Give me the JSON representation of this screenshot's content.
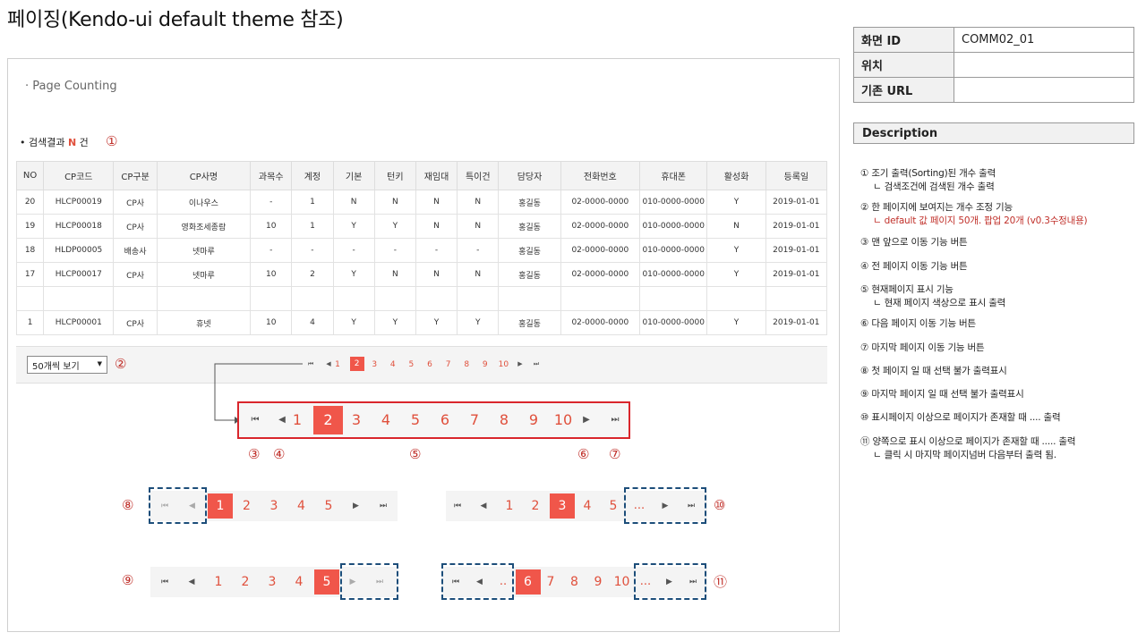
{
  "title": "페이징(Kendo-ui default theme 참조)",
  "section_title": "· Page Counting",
  "result": {
    "prefix": "• 검색결과 ",
    "n": "N",
    "suffix": " 건"
  },
  "markers": [
    "①",
    "②",
    "③",
    "④",
    "⑤",
    "⑥",
    "⑦",
    "⑧",
    "⑨",
    "⑩",
    "⑪"
  ],
  "grid": {
    "columns": [
      "NO",
      "CP코드",
      "CP구분",
      "CP사명",
      "과목수",
      "계정",
      "기본",
      "턴키",
      "재임대",
      "특이건",
      "담당자",
      "전화번호",
      "휴대폰",
      "활성화",
      "등록일"
    ],
    "rows": [
      [
        "20",
        "HLCP00019",
        "CP사",
        "이나우스",
        "-",
        "1",
        "N",
        "N",
        "N",
        "N",
        "홍길동",
        "02-0000-0000",
        "010-0000-0000",
        "Y",
        "2019-01-01"
      ],
      [
        "19",
        "HLCP00018",
        "CP사",
        "영화조세종람",
        "10",
        "1",
        "Y",
        "Y",
        "N",
        "N",
        "홍길동",
        "02-0000-0000",
        "010-0000-0000",
        "N",
        "2019-01-01"
      ],
      [
        "18",
        "HLDP00005",
        "배송사",
        "넷마루",
        "-",
        "-",
        "-",
        "-",
        "-",
        "-",
        "홍길동",
        "02-0000-0000",
        "010-0000-0000",
        "Y",
        "2019-01-01"
      ],
      [
        "17",
        "HLCP00017",
        "CP사",
        "넷마루",
        "10",
        "2",
        "Y",
        "N",
        "N",
        "N",
        "홍길동",
        "02-0000-0000",
        "010-0000-0000",
        "Y",
        "2019-01-01"
      ],
      [
        "",
        "",
        "",
        "",
        "",
        "",
        "",
        "",
        "",
        "",
        "",
        "",
        "",
        "",
        ""
      ],
      [
        "1",
        "HLCP00001",
        "CP사",
        "휴넷",
        "10",
        "4",
        "Y",
        "Y",
        "Y",
        "Y",
        "홍길동",
        "02-0000-0000",
        "010-0000-0000",
        "Y",
        "2019-01-01"
      ]
    ]
  },
  "page_size_label": "50개씩 보기",
  "pager": {
    "first": "⏮",
    "prev": "◀",
    "next": "▶",
    "last": "⏭",
    "pages": [
      "1",
      "2",
      "3",
      "4",
      "5",
      "6",
      "7",
      "8",
      "9",
      "10"
    ],
    "current": "2"
  },
  "examples": {
    "first_page": {
      "pages": [
        "1",
        "2",
        "3",
        "4",
        "5"
      ],
      "current": "1"
    },
    "last_page": {
      "pages": [
        "1",
        "2",
        "3",
        "4",
        "5"
      ],
      "current": "5"
    },
    "more_right": {
      "pages": [
        "1",
        "2",
        "3",
        "4",
        "5"
      ],
      "current": "3",
      "dots": "..."
    },
    "both_sides": {
      "pages": [
        "6",
        "7",
        "8",
        "9",
        "10"
      ],
      "current": "6",
      "dots_left": "..",
      "dots_right": "..."
    }
  },
  "screen_info": {
    "rows": [
      {
        "key": "화면 ID",
        "value": "COMM02_01"
      },
      {
        "key": "위치",
        "value": ""
      },
      {
        "key": "기존 URL",
        "value": ""
      }
    ]
  },
  "description_header": "Description",
  "descriptions": [
    {
      "main": "① 조기 출력(Sorting)된 개수 출력",
      "sub": "ㄴ 검색조건에 검색된 개수 출력",
      "sub_red": false
    },
    {
      "main": "② 한 페이지에 보여지는 개수 조정 기능",
      "sub": "ㄴ default 값 페이지 50개. 팝업 20개 (v0.3수정내용)",
      "sub_red": true
    },
    {
      "main": "③ 맨 앞으로 이동 기능 버튼",
      "sub": "",
      "sub_red": false
    },
    {
      "main": "④ 전 페이지 이동 기능 버튼",
      "sub": "",
      "sub_red": false
    },
    {
      "main": "⑤ 현재페이지 표시 기능",
      "sub": "ㄴ 현재 페이지 색상으로 표시 출력",
      "sub_red": false
    },
    {
      "main": "⑥ 다음 페이지 이동 기능 버튼",
      "sub": "",
      "sub_red": false
    },
    {
      "main": "⑦ 마지막 페이지 이동 기능 버튼",
      "sub": "",
      "sub_red": false
    },
    {
      "main": "⑧ 첫 페이지 일 때 선택 불가 출력표시",
      "sub": "",
      "sub_red": false
    },
    {
      "main": "⑨ 마지막 페이지 일 때 선택 불가 출력표시",
      "sub": "",
      "sub_red": false
    },
    {
      "main": "⑩ 표시페이지 이상으로 페이지가 존재할 때 .... 출력",
      "sub": "",
      "sub_red": false
    },
    {
      "main": "⑪ 양쪽으로 표시 이상으로 페이지가 존재할 때 ..... 출력",
      "sub": "ㄴ 클릭 시 마지막 페이지넘버 다음부터 출력 됨.",
      "sub_red": false
    }
  ]
}
